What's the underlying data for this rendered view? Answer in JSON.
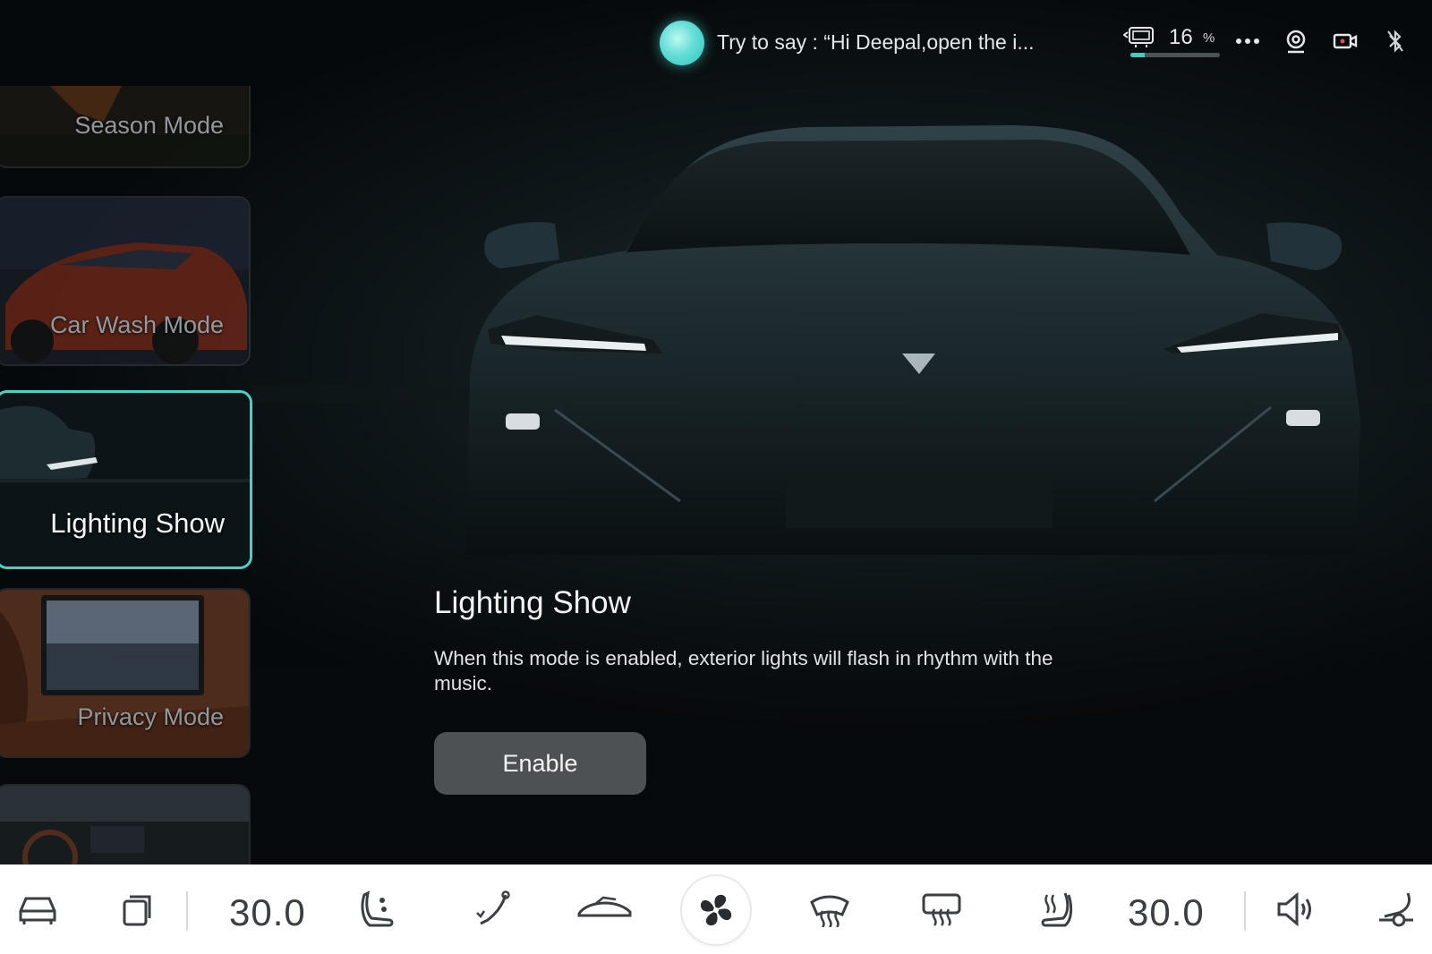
{
  "topbar": {
    "voice_hint": "Try to say : “Hi Deepal,open the i...",
    "battery_value": "16",
    "battery_unit": "%",
    "battery_level": 0.16,
    "icons": [
      "battery-icon",
      "more-icon",
      "camera-icon",
      "dashcam-icon",
      "bluetooth-icon"
    ]
  },
  "modes": [
    {
      "label": "Season Mode",
      "active": false
    },
    {
      "label": "Car Wash Mode",
      "active": false
    },
    {
      "label": "Lighting Show",
      "active": true
    },
    {
      "label": "Privacy Mode",
      "active": false
    },
    {
      "label": "",
      "active": false
    }
  ],
  "content": {
    "title": "Lighting Show",
    "description": "When this mode is enabled, exterior lights will flash in rhythm with the music.",
    "enable_label": "Enable"
  },
  "dock": {
    "temp_left": "30.0",
    "temp_right": "30.0",
    "icons": [
      "car-icon",
      "windows-icon",
      "seat-massage-icon",
      "seat-recline-icon",
      "car-profile-icon",
      "fan-icon",
      "front-defrost-icon",
      "rear-defrost-icon",
      "seat-heat-icon",
      "volume-icon",
      "steering-heat-icon"
    ]
  },
  "colors": {
    "accent": "#45d3c7",
    "dock_bg": "#ffffff",
    "button_bg": "#4e5153"
  }
}
